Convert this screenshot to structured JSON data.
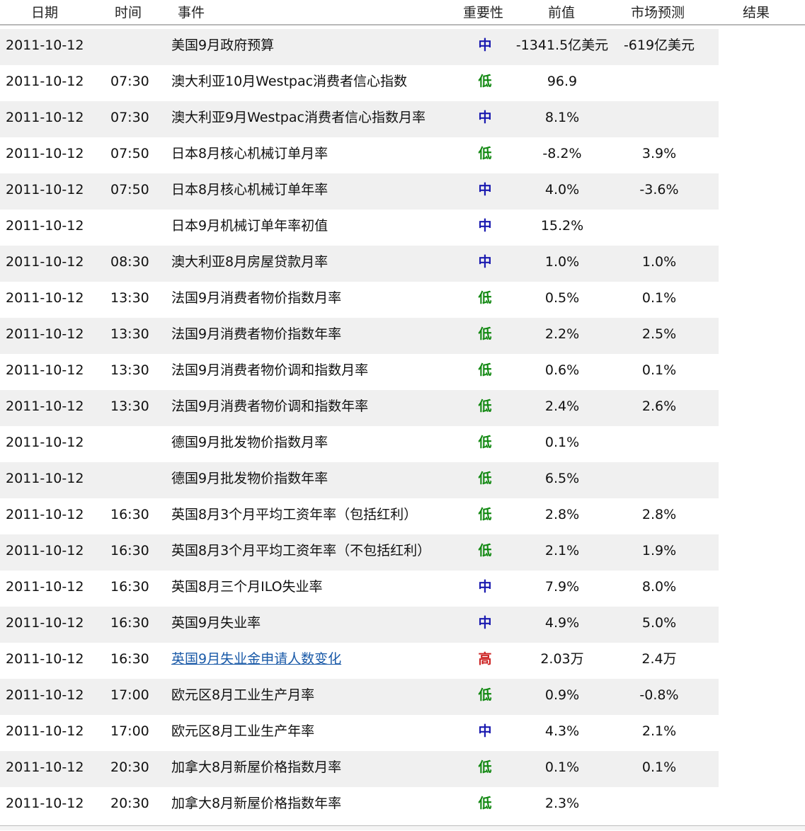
{
  "header": {
    "date": "日期",
    "time": "时间",
    "event": "事件",
    "importance": "重要性",
    "previous": "前值",
    "forecast": "市场预测",
    "result": "结果"
  },
  "colors": {
    "low": "#118811",
    "mid": "#1a1ab0",
    "high": "#cc2222",
    "link": "#1a5aa8"
  },
  "rows": [
    {
      "date": "2011-10-12",
      "time": "",
      "event": "美国9月政府预算",
      "importance": "中",
      "level": "mid",
      "previous": "-1341.5亿美元",
      "forecast": "-619亿美元",
      "result": "",
      "link": false
    },
    {
      "date": "2011-10-12",
      "time": "07:30",
      "event": "澳大利亚10月Westpac消费者信心指数",
      "importance": "低",
      "level": "low",
      "previous": "96.9",
      "forecast": "",
      "result": "",
      "link": false
    },
    {
      "date": "2011-10-12",
      "time": "07:30",
      "event": "澳大利亚9月Westpac消费者信心指数月率",
      "importance": "中",
      "level": "mid",
      "previous": "8.1%",
      "forecast": "",
      "result": "",
      "link": false
    },
    {
      "date": "2011-10-12",
      "time": "07:50",
      "event": "日本8月核心机械订单月率",
      "importance": "低",
      "level": "low",
      "previous": "-8.2%",
      "forecast": "3.9%",
      "result": "",
      "link": false
    },
    {
      "date": "2011-10-12",
      "time": "07:50",
      "event": "日本8月核心机械订单年率",
      "importance": "中",
      "level": "mid",
      "previous": "4.0%",
      "forecast": "-3.6%",
      "result": "",
      "link": false
    },
    {
      "date": "2011-10-12",
      "time": "",
      "event": "日本9月机械订单年率初值",
      "importance": "中",
      "level": "mid",
      "previous": "15.2%",
      "forecast": "",
      "result": "",
      "link": false
    },
    {
      "date": "2011-10-12",
      "time": "08:30",
      "event": "澳大利亚8月房屋贷款月率",
      "importance": "中",
      "level": "mid",
      "previous": "1.0%",
      "forecast": "1.0%",
      "result": "",
      "link": false
    },
    {
      "date": "2011-10-12",
      "time": "13:30",
      "event": "法国9月消费者物价指数月率",
      "importance": "低",
      "level": "low",
      "previous": "0.5%",
      "forecast": "0.1%",
      "result": "",
      "link": false
    },
    {
      "date": "2011-10-12",
      "time": "13:30",
      "event": "法国9月消费者物价指数年率",
      "importance": "低",
      "level": "low",
      "previous": "2.2%",
      "forecast": "2.5%",
      "result": "",
      "link": false
    },
    {
      "date": "2011-10-12",
      "time": "13:30",
      "event": "法国9月消费者物价调和指数月率",
      "importance": "低",
      "level": "low",
      "previous": "0.6%",
      "forecast": "0.1%",
      "result": "",
      "link": false
    },
    {
      "date": "2011-10-12",
      "time": "13:30",
      "event": "法国9月消费者物价调和指数年率",
      "importance": "低",
      "level": "low",
      "previous": "2.4%",
      "forecast": "2.6%",
      "result": "",
      "link": false
    },
    {
      "date": "2011-10-12",
      "time": "",
      "event": "德国9月批发物价指数月率",
      "importance": "低",
      "level": "low",
      "previous": "0.1%",
      "forecast": "",
      "result": "",
      "link": false
    },
    {
      "date": "2011-10-12",
      "time": "",
      "event": "德国9月批发物价指数年率",
      "importance": "低",
      "level": "low",
      "previous": "6.5%",
      "forecast": "",
      "result": "",
      "link": false
    },
    {
      "date": "2011-10-12",
      "time": "16:30",
      "event": "英国8月3个月平均工资年率（包括红利）",
      "importance": "低",
      "level": "low",
      "previous": "2.8%",
      "forecast": "2.8%",
      "result": "",
      "link": false
    },
    {
      "date": "2011-10-12",
      "time": "16:30",
      "event": "英国8月3个月平均工资年率（不包括红利）",
      "importance": "低",
      "level": "low",
      "previous": "2.1%",
      "forecast": "1.9%",
      "result": "",
      "link": false
    },
    {
      "date": "2011-10-12",
      "time": "16:30",
      "event": "英国8月三个月ILO失业率",
      "importance": "中",
      "level": "mid",
      "previous": "7.9%",
      "forecast": "8.0%",
      "result": "",
      "link": false
    },
    {
      "date": "2011-10-12",
      "time": "16:30",
      "event": "英国9月失业率",
      "importance": "中",
      "level": "mid",
      "previous": "4.9%",
      "forecast": "5.0%",
      "result": "",
      "link": false
    },
    {
      "date": "2011-10-12",
      "time": "16:30",
      "event": "英国9月失业金申请人数变化",
      "importance": "高",
      "level": "high",
      "previous": "2.03万",
      "forecast": "2.4万",
      "result": "",
      "link": true
    },
    {
      "date": "2011-10-12",
      "time": "17:00",
      "event": "欧元区8月工业生产月率",
      "importance": "低",
      "level": "low",
      "previous": "0.9%",
      "forecast": "-0.8%",
      "result": "",
      "link": false
    },
    {
      "date": "2011-10-12",
      "time": "17:00",
      "event": "欧元区8月工业生产年率",
      "importance": "中",
      "level": "mid",
      "previous": "4.3%",
      "forecast": "2.1%",
      "result": "",
      "link": false
    },
    {
      "date": "2011-10-12",
      "time": "20:30",
      "event": "加拿大8月新屋价格指数月率",
      "importance": "低",
      "level": "low",
      "previous": "0.1%",
      "forecast": "0.1%",
      "result": "",
      "link": false
    },
    {
      "date": "2011-10-12",
      "time": "20:30",
      "event": "加拿大8月新屋价格指数年率",
      "importance": "低",
      "level": "low",
      "previous": "2.3%",
      "forecast": "",
      "result": "",
      "link": false
    }
  ]
}
